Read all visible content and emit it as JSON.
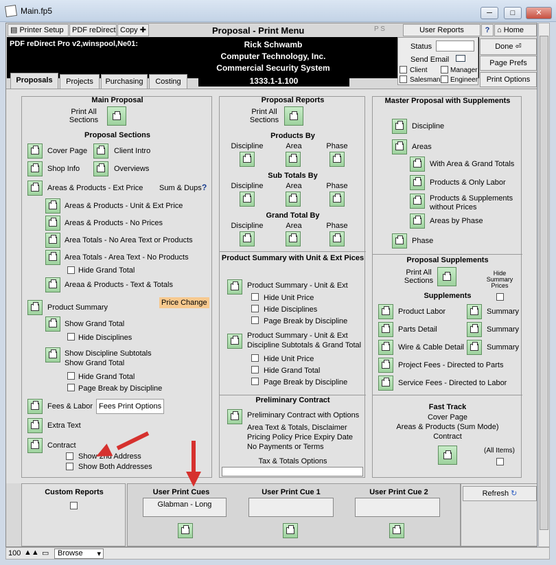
{
  "window": {
    "title": "Main.fp5",
    "min": "─",
    "max": "□",
    "close": "✕"
  },
  "toolbar": {
    "printer_setup": "Printer Setup",
    "pdf_redirect": "PDF reDirect",
    "copy": "Copy",
    "title": "Proposal - Print Menu",
    "ps": "P  S",
    "user_reports": "User Reports",
    "help": "?",
    "home": "Home",
    "done": "Done",
    "page_prefs": "Page Prefs",
    "print_options": "Print Options"
  },
  "header": {
    "printer": "PDF reDirect Pro v2,winspool,Ne01:",
    "name": "Rick Schwamb",
    "company": "Computer Technology, Inc.",
    "system": "Commercial Security System",
    "version": "1333.1-1.100"
  },
  "status_box": {
    "status": "Status",
    "send_email": "Send Email",
    "client": "Client",
    "manager": "Manager",
    "salesman": "Salesman",
    "engineer": "Engineer"
  },
  "tabs": [
    "Proposals",
    "Projects",
    "Purchasing",
    "Costing"
  ],
  "main": {
    "title": "Main Proposal",
    "print_all": "Print All Sections",
    "sections_title": "Proposal Sections",
    "cover_page": "Cover Page",
    "client_intro": "Client Intro",
    "shop_info": "Shop Info",
    "overviews": "Overviews",
    "areas_ext": "Areas & Products - Ext Price",
    "sum_dups": "Sum & Dups",
    "areas_unit_ext": "Areas & Products - Unit & Ext Price",
    "areas_no_prices": "Areas & Products - No Prices",
    "area_totals_none": "Area Totals - No Area Text or Products",
    "area_totals_text": "Area Totals - Area Text - No Products",
    "hide_grand_total": "Hide Grand Total",
    "areas_text_totals": "Areaa & Products - Text & Totals",
    "product_summary": "Product Summary",
    "price_change": "Price Change",
    "show_grand_total": "Show Grand Total",
    "hide_disciplines": "Hide Disciplines",
    "show_disc_subtotals": "Show Discipline Subtotals",
    "show_grand_total2": "Show Grand Total",
    "hide_grand_total2": "Hide Grand Total",
    "page_break": "Page Break by Discipline",
    "fees_labor": "Fees & Labor",
    "fees_print_options": "Fees Print Options",
    "extra_text": "Extra Text",
    "contract": "Contract",
    "show_2nd_address": "Show 2nd Address",
    "show_both_addresses": "Show Both Addresses"
  },
  "reports": {
    "title": "Proposal Reports",
    "print_all": "Print All Sections",
    "products_by": "Products By",
    "discipline": "Discipline",
    "area": "Area",
    "phase": "Phase",
    "sub_totals_by": "Sub Totals By",
    "grand_total_by": "Grand Total By",
    "ps_title": "Product Summary with Unit & Ext Pices",
    "ps_unit_ext": "Product Summary - Unit & Ext",
    "hide_unit_price": "Hide Unit Price",
    "hide_disciplines": "Hide Disciplines",
    "page_break": "Page Break by Discipline",
    "ps_disc_sub": "Product Summary - Unit & Ext",
    "ps_disc_sub2": "Discipline Subtotals & Grand Total",
    "hide_unit_price2": "Hide Unit Price",
    "hide_grand_total": "Hide Grand Total",
    "page_break2": "Page Break by Discipline",
    "prelim_title": "Preliminary Contract",
    "prelim_options": "Preliminary Contract with Options",
    "prelim_l2": "Area Text & Totals, Disclaimer",
    "prelim_l3": "Pricing Policy Price Expiry Date",
    "prelim_l4": "No Payments or Terms",
    "tax_totals": "Tax & Totals Options"
  },
  "master": {
    "title": "Master Proposal with Supplements",
    "discipline": "Discipline",
    "areas": "Areas",
    "with_area_totals": "With Area & Grand Totals",
    "products_only_labor": "Products & Only Labor",
    "products_supp": "Products & Supplements",
    "products_supp2": "without Prices",
    "areas_by_phase": "Areas by Phase",
    "phase": "Phase",
    "supp_title": "Proposal Supplements",
    "print_all": "Print All Sections",
    "hide_summary": "Hide Summary Prices",
    "supplements": "Supplements",
    "product_labor": "Product Labor",
    "summary": "Summary",
    "parts_detail": "Parts Detail",
    "wire_cable": "Wire & Cable Detail",
    "project_fees": "Project Fees - Directed to Parts",
    "service_fees": "Service Fees - Directed to Labor",
    "fast_track": "Fast Track",
    "ft_cover": "Cover Page",
    "ft_areas": "Areas & Products (Sum Mode)",
    "ft_contract": "Contract",
    "all_items": "(All Items)"
  },
  "bottom": {
    "custom_reports": "Custom Reports",
    "cues": "User Print Cues",
    "cue_value": "Glabman - Long",
    "cue1": "User Print Cue 1",
    "cue2": "User Print Cue 2",
    "refresh": "Refresh"
  },
  "statusbar": {
    "zoom": "100",
    "mode": "Browse"
  }
}
